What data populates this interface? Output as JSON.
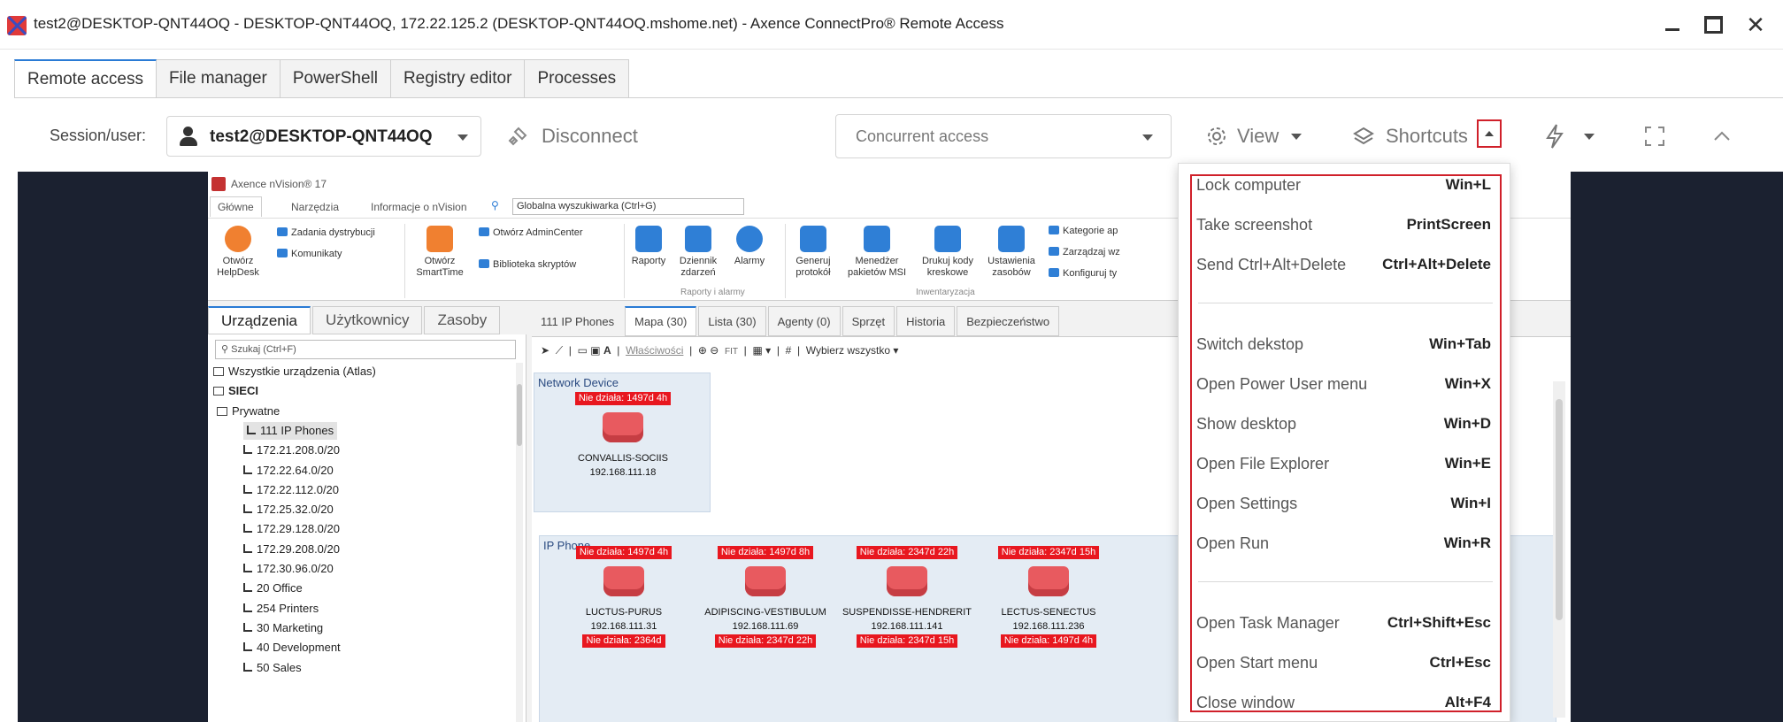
{
  "window": {
    "title": "test2@DESKTOP-QNT44OQ - DESKTOP-QNT44OQ, 172.22.125.2 (DESKTOP-QNT44OQ.mshome.net) - Axence ConnectPro® Remote Access"
  },
  "tabs": [
    "Remote access",
    "File manager",
    "PowerShell",
    "Registry editor",
    "Processes"
  ],
  "toolbar": {
    "session_label": "Session/user:",
    "session_value": "test2@DESKTOP-QNT44OQ",
    "disconnect_label": "Disconnect",
    "access_mode": "Concurrent access",
    "view_label": "View",
    "shortcuts_label": "Shortcuts"
  },
  "shortcuts_menu": {
    "items": [
      {
        "label": "Lock computer",
        "keys": "Win+L"
      },
      {
        "label": "Take screenshot",
        "keys": "PrintScreen"
      },
      {
        "label": "Send Ctrl+Alt+Delete",
        "keys": "Ctrl+Alt+Delete"
      },
      {
        "label": "Switch dekstop",
        "keys": "Win+Tab"
      },
      {
        "label": "Open Power User menu",
        "keys": "Win+X"
      },
      {
        "label": "Show desktop",
        "keys": "Win+D"
      },
      {
        "label": "Open File Explorer",
        "keys": "Win+E"
      },
      {
        "label": "Open Settings",
        "keys": "Win+I"
      },
      {
        "label": "Open Run",
        "keys": "Win+R"
      },
      {
        "label": "Open Task Manager",
        "keys": "Ctrl+Shift+Esc"
      },
      {
        "label": "Open Start menu",
        "keys": "Ctrl+Esc"
      },
      {
        "label": "Close window",
        "keys": "Alt+F4"
      }
    ]
  },
  "remote": {
    "app_title": "Axence nVision® 17",
    "menu": [
      "Główne",
      "Narzędzia",
      "Informacje o nVision"
    ],
    "search_placeholder": "Globalna wyszukiwarka (Ctrl+G)",
    "ribbon": {
      "helpdesk": "Otwórz HelpDesk",
      "smarttime": "Otwórz SmartTime",
      "zadania": "Zadania dystrybucji",
      "komunikaty": "Komunikaty",
      "admincenter": "Otwórz AdminCenter",
      "biblioteka": "Biblioteka skryptów",
      "raporty": "Raporty",
      "dziennik": "Dziennik zdarzeń",
      "alarmy": "Alarmy",
      "generuj": "Generuj protokół",
      "menedzer": "Menedżer pakietów MSI",
      "drukuj": "Drukuj kody kreskowe",
      "ustawienia": "Ustawienia zasobów",
      "kategorie": "Kategorie ap",
      "zarzadzaj": "Zarządzaj wz",
      "konfiguruj": "Konfiguruj ty",
      "group_raporty": "Raporty i alarmy",
      "group_inwentaryzacja": "Inwentaryzacja"
    },
    "left_tabs": [
      "Urządzenia",
      "Użytkownicy",
      "Zasoby"
    ],
    "left_search": "Szukaj (Ctrl+F)",
    "tree": [
      "Wszystkie urządzenia (Atlas)",
      "SIECI",
      "Prywatne",
      "111 IP Phones",
      "172.21.208.0/20",
      "172.22.64.0/20",
      "172.22.112.0/20",
      "172.25.32.0/20",
      "172.29.128.0/20",
      "172.29.208.0/20",
      "172.30.96.0/20",
      "20 Office",
      "254 Printers",
      "30 Marketing",
      "40 Development",
      "50 Sales"
    ],
    "map_tabs": [
      "111 IP Phones",
      "Mapa (30)",
      "Lista (30)",
      "Agenty (0)",
      "Sprzęt",
      "Historia",
      "Bezpieczeństwo"
    ],
    "map_tools": {
      "properties": "Właściwości",
      "fit": "FIT",
      "select_all": "Wybierz wszystko"
    },
    "group_network": "Network Device",
    "group_phone": "IP Phone",
    "network_device": {
      "badge": "Nie działa: 1497d 4h",
      "name": "CONVALLIS-SOCIIS",
      "ip": "192.168.111.18"
    },
    "phones": [
      {
        "badge": "Nie działa: 1497d 4h",
        "name": "LUCTUS-PURUS",
        "ip": "192.168.111.31",
        "badge2": "Nie działa: 2364d"
      },
      {
        "badge": "Nie działa: 1497d 8h",
        "name": "ADIPISCING-VESTIBULUM",
        "ip": "192.168.111.69",
        "badge2": "Nie działa: 2347d 22h"
      },
      {
        "badge": "Nie działa: 2347d 22h",
        "name": "SUSPENDISSE-HENDRERIT",
        "ip": "192.168.111.141",
        "badge2": "Nie działa: 2347d 15h"
      },
      {
        "badge": "Nie działa: 2347d 15h",
        "name": "LECTUS-SENECTUS",
        "ip": "192.168.111.236",
        "badge2": "Nie działa: 1497d 4h"
      }
    ]
  }
}
